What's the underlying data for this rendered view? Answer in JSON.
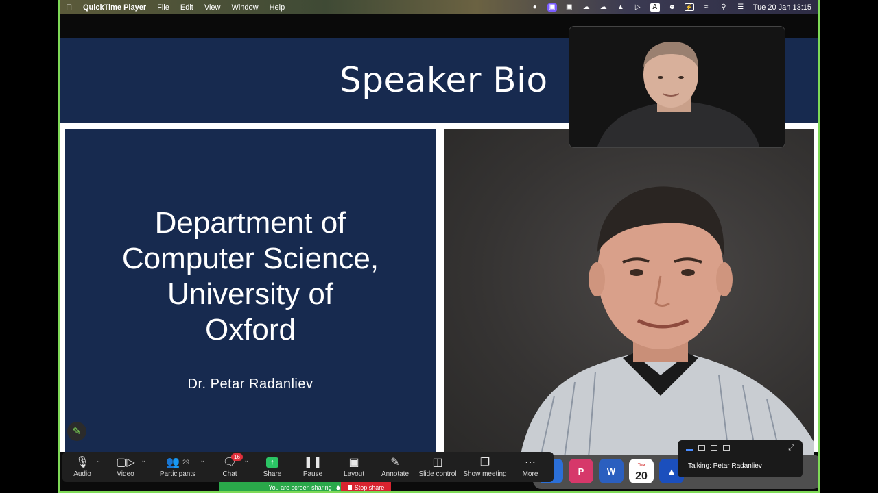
{
  "menubar": {
    "app_name": "QuickTime Player",
    "menus": [
      "File",
      "Edit",
      "View",
      "Window",
      "Help"
    ],
    "status_letter": "A",
    "clock": "Tue 20 Jan  13:15"
  },
  "slide": {
    "title": "Speaker Bio",
    "department": "Department of Computer Science, University of Oxford",
    "department_lines": [
      "Department of",
      "Computer Science,",
      "University of",
      "Oxford"
    ],
    "speaker_name": "Dr. Petar Radanliev"
  },
  "toolbar": {
    "audio_label": "Audio",
    "video_label": "Video",
    "participants_label": "Participants",
    "participants_count": "29",
    "chat_label": "Chat",
    "chat_badge": "16",
    "share_label": "Share",
    "pause_label": "Pause",
    "layout_label": "Layout",
    "annotate_label": "Annotate",
    "slide_control_label": "Slide control",
    "show_meeting_label": "Show meeting",
    "more_label": "More"
  },
  "sharing": {
    "status_text": "You are screen sharing",
    "stop_label": "Stop share"
  },
  "talking": {
    "text": "Talking: Petar Radanliev"
  },
  "dock": {
    "calendar_day": "20",
    "calendar_month": "Tue"
  },
  "colors": {
    "slide_navy": "#172a4f",
    "sharing_green": "#2aa84a",
    "stop_red": "#d8232f",
    "frame_green": "#7ed957"
  }
}
